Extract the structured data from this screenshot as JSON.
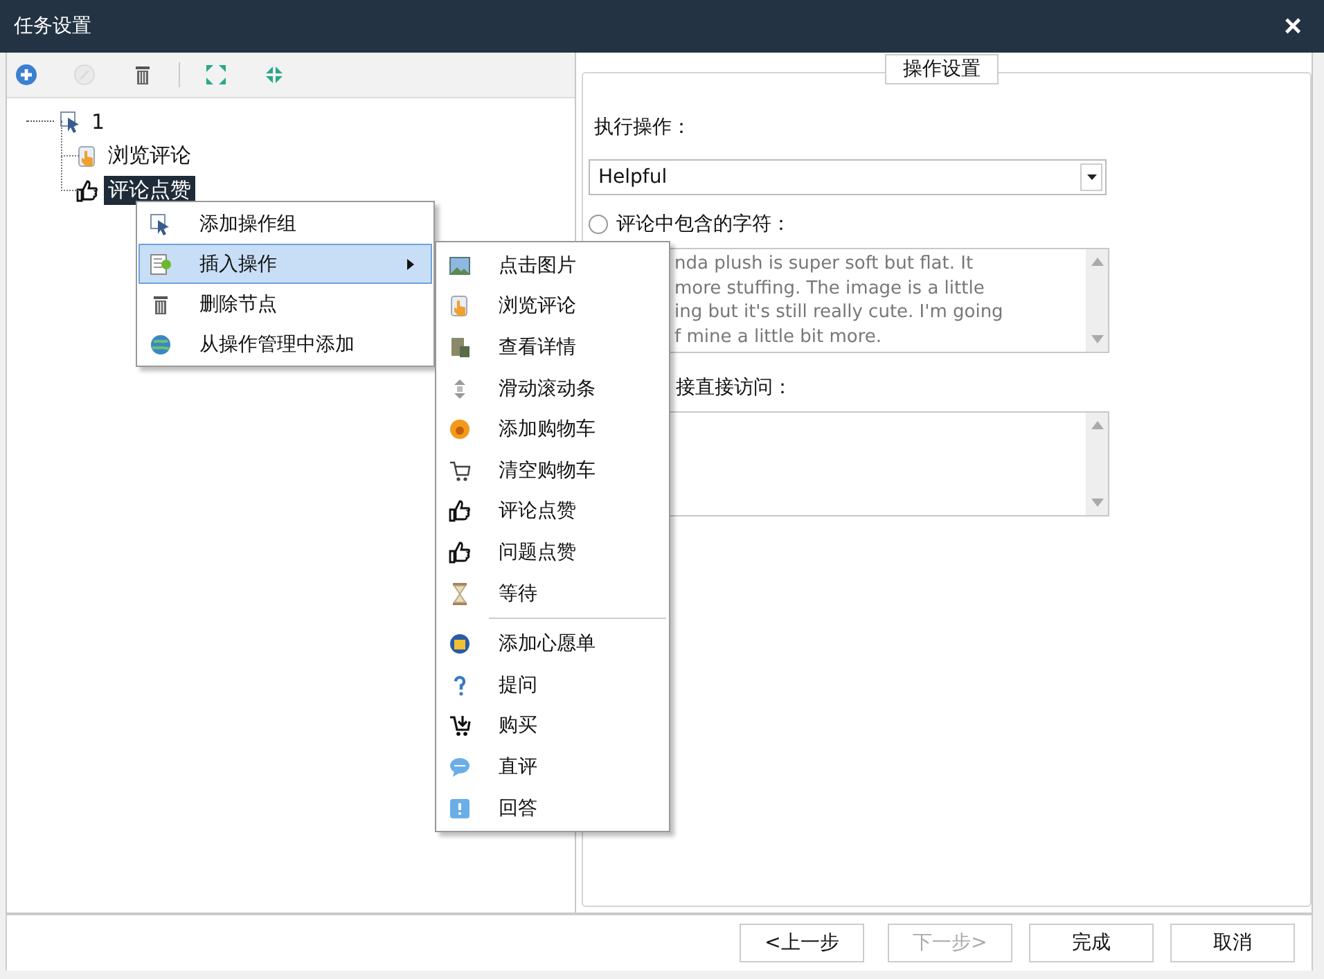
{
  "window": {
    "title": "任务设置",
    "close": "×"
  },
  "toolbar": [
    {
      "kind": "add",
      "disabled": false
    },
    {
      "kind": "remove",
      "disabled": true
    },
    {
      "kind": "trash",
      "disabled": false
    },
    {
      "kind": "expand",
      "disabled": false
    },
    {
      "kind": "collapse",
      "disabled": false
    }
  ],
  "tree": {
    "label": "1",
    "kind": "pointer",
    "expanded": true,
    "children": [
      {
        "label": "浏览评论",
        "kind": "hand",
        "selected": false
      },
      {
        "label": "评论点赞",
        "kind": "thumb",
        "selected": true
      }
    ]
  },
  "context_menu": [
    {
      "label": "添加操作组",
      "kind": "pointer",
      "selected": false,
      "submenu": false
    },
    {
      "label": "插入操作",
      "kind": "insert",
      "selected": true,
      "submenu": true
    },
    {
      "label": "删除节点",
      "kind": "trash",
      "selected": false,
      "submenu": false
    },
    {
      "label": "从操作管理中添加",
      "kind": "globe",
      "selected": false,
      "submenu": false
    }
  ],
  "submenu": [
    [
      {
        "label": "点击图片",
        "kind": "image"
      },
      {
        "label": "浏览评论",
        "kind": "hand"
      },
      {
        "label": "查看详情",
        "kind": "doc"
      },
      {
        "label": "滑动滚动条",
        "kind": "scroll"
      },
      {
        "label": "添加购物车",
        "kind": "orange"
      },
      {
        "label": "清空购物车",
        "kind": "cart"
      },
      {
        "label": "评论点赞",
        "kind": "thumb"
      },
      {
        "label": "问题点赞",
        "kind": "thumb"
      },
      {
        "label": "等待",
        "kind": "hourglass"
      }
    ],
    [
      {
        "label": "添加心愿单",
        "kind": "wish"
      },
      {
        "label": "提问",
        "kind": "question"
      },
      {
        "label": "购买",
        "kind": "buy"
      },
      {
        "label": "直评",
        "kind": "bubble"
      },
      {
        "label": "回答",
        "kind": "answer"
      }
    ]
  ],
  "settings": {
    "title": "操作设置",
    "action_label": "执行操作：",
    "action_value": "Helpful",
    "contains": {
      "label": "评论中包含的字符：",
      "checked": false,
      "lines": [
        "nda plush is super soft but flat. It",
        "more stuffing. The image is a little",
        "ing but it's still really cute. I'm going",
        "f mine a little bit more."
      ]
    },
    "link": {
      "label": "接直接访问："
    }
  },
  "buttons": [
    {
      "label": "<上一步",
      "disabled": false
    },
    {
      "label": "下一步>",
      "disabled": true
    },
    {
      "label": "完成",
      "disabled": false
    },
    {
      "label": "取消",
      "disabled": false
    }
  ]
}
